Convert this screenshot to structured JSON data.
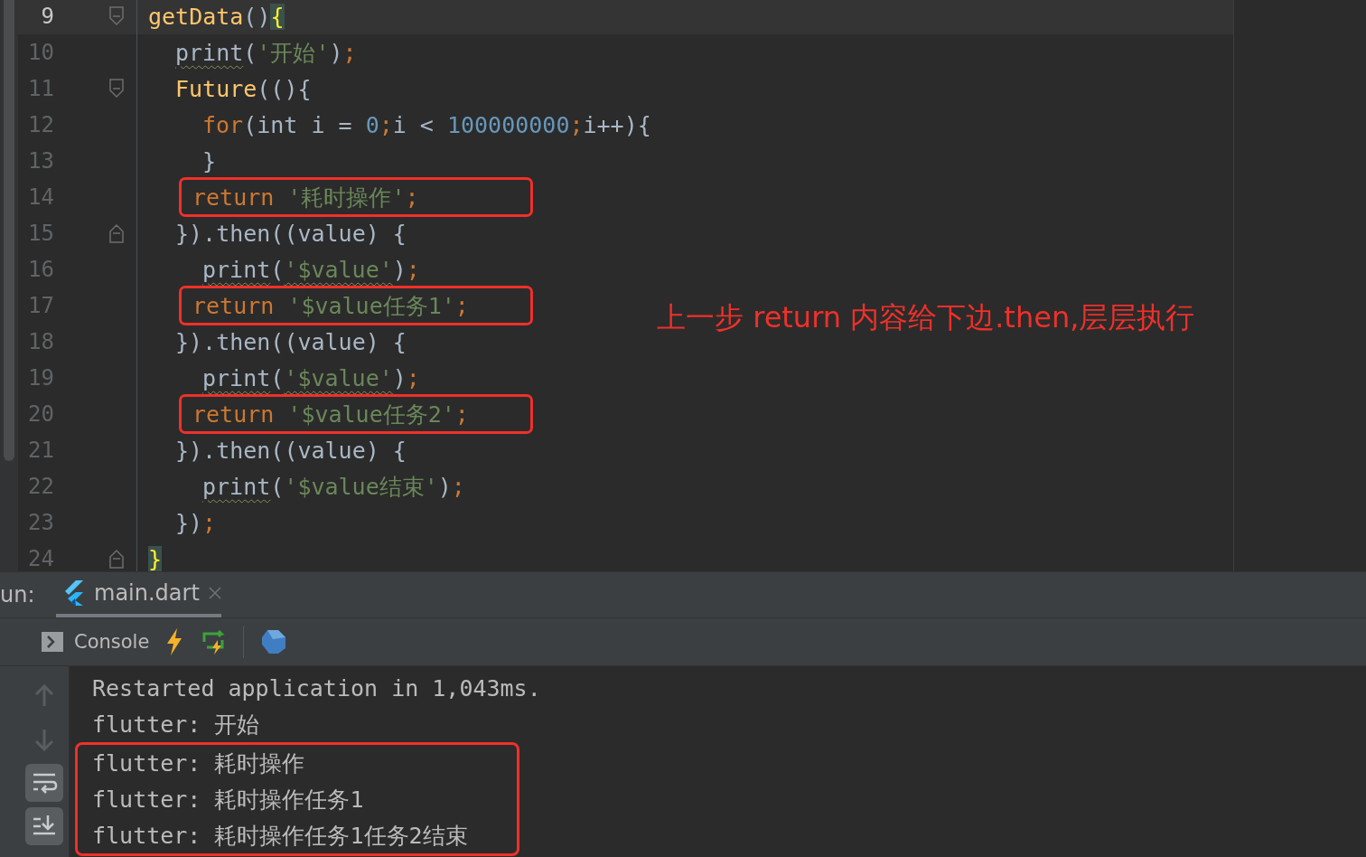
{
  "editor": {
    "lines": [
      {
        "number": "9",
        "kind": "opener",
        "current": true,
        "boxed": false,
        "tokens": [
          {
            "kind": "fn",
            "text": "getData"
          },
          {
            "kind": "plain",
            "text": "()"
          },
          {
            "kind": "brace",
            "text": "{"
          }
        ],
        "children": [
          {
            "number": "10",
            "kind": "plain",
            "current": false,
            "boxed": false,
            "tokens": [
              {
                "kind": "warn",
                "text": "print"
              },
              {
                "kind": "plain",
                "text": "("
              },
              {
                "kind": "str",
                "text": "'开始'"
              },
              {
                "kind": "plain",
                "text": ")"
              },
              {
                "kind": "kw",
                "text": ";"
              }
            ]
          },
          {
            "number": "11",
            "kind": "opener",
            "current": false,
            "boxed": false,
            "tokens": [
              {
                "kind": "fn",
                "text": "Future"
              },
              {
                "kind": "plain",
                "text": "((){"
              }
            ],
            "children": [
              {
                "number": "12",
                "kind": "plain",
                "current": false,
                "boxed": false,
                "tokens": [
                  {
                    "kind": "kw",
                    "text": "for"
                  },
                  {
                    "kind": "plain",
                    "text": "(int i = "
                  },
                  {
                    "kind": "num",
                    "text": "0"
                  },
                  {
                    "kind": "kw",
                    "text": ";"
                  },
                  {
                    "kind": "plain",
                    "text": "i < "
                  },
                  {
                    "kind": "num",
                    "text": "100000000"
                  },
                  {
                    "kind": "kw",
                    "text": ";"
                  },
                  {
                    "kind": "plain",
                    "text": "i++){"
                  }
                ]
              },
              {
                "number": "13",
                "kind": "plain",
                "current": false,
                "boxed": false,
                "tokens": [
                  {
                    "kind": "plain",
                    "text": "}"
                  }
                ]
              },
              {
                "number": "14",
                "kind": "plain",
                "current": false,
                "boxed": true,
                "tokens": [
                  {
                    "kind": "kw",
                    "text": "return "
                  },
                  {
                    "kind": "str",
                    "text": "'耗时操作'"
                  },
                  {
                    "kind": "kw",
                    "text": ";"
                  }
                ]
              }
            ]
          },
          {
            "number": "15",
            "kind": "closer",
            "current": false,
            "boxed": false,
            "tokens": [
              {
                "kind": "plain",
                "text": "}).then((value) {"
              }
            ],
            "children": [
              {
                "number": "16",
                "kind": "plain",
                "current": false,
                "boxed": false,
                "tokens": [
                  {
                    "kind": "warn",
                    "text": "print"
                  },
                  {
                    "kind": "plain",
                    "text": "("
                  },
                  {
                    "kind": "strwarn",
                    "text": "'$value'"
                  },
                  {
                    "kind": "plain",
                    "text": ")"
                  },
                  {
                    "kind": "kw",
                    "text": ";"
                  }
                ]
              },
              {
                "number": "17",
                "kind": "plain",
                "current": false,
                "boxed": true,
                "tokens": [
                  {
                    "kind": "kw",
                    "text": "return "
                  },
                  {
                    "kind": "str",
                    "text": "'$value任务1'"
                  },
                  {
                    "kind": "kw",
                    "text": ";"
                  }
                ]
              }
            ]
          },
          {
            "number": "18",
            "kind": "plain",
            "current": false,
            "boxed": false,
            "tokens": [
              {
                "kind": "plain",
                "text": "}).then((value) {"
              }
            ],
            "children": [
              {
                "number": "19",
                "kind": "plain",
                "current": false,
                "boxed": false,
                "tokens": [
                  {
                    "kind": "warn",
                    "text": "print"
                  },
                  {
                    "kind": "plain",
                    "text": "("
                  },
                  {
                    "kind": "strwarn",
                    "text": "'$value'"
                  },
                  {
                    "kind": "plain",
                    "text": ")"
                  },
                  {
                    "kind": "kw",
                    "text": ";"
                  }
                ]
              },
              {
                "number": "20",
                "kind": "plain",
                "current": false,
                "boxed": true,
                "tokens": [
                  {
                    "kind": "kw",
                    "text": "return "
                  },
                  {
                    "kind": "str",
                    "text": "'$value任务2'"
                  },
                  {
                    "kind": "kw",
                    "text": ";"
                  }
                ]
              }
            ]
          },
          {
            "number": "21",
            "kind": "plain",
            "current": false,
            "boxed": false,
            "tokens": [
              {
                "kind": "plain",
                "text": "}).then((value) {"
              }
            ],
            "children": [
              {
                "number": "22",
                "kind": "plain",
                "current": false,
                "boxed": false,
                "tokens": [
                  {
                    "kind": "warn",
                    "text": "print"
                  },
                  {
                    "kind": "plain",
                    "text": "("
                  },
                  {
                    "kind": "str",
                    "text": "'$value结束'"
                  },
                  {
                    "kind": "plain",
                    "text": ")"
                  },
                  {
                    "kind": "kw",
                    "text": ";"
                  }
                ]
              }
            ]
          },
          {
            "number": "23",
            "kind": "plain",
            "current": false,
            "boxed": false,
            "tokens": [
              {
                "kind": "plain",
                "text": "})"
              },
              {
                "kind": "kw",
                "text": ";"
              }
            ]
          }
        ]
      },
      {
        "number": "24",
        "kind": "closer",
        "current": false,
        "boxed": false,
        "tokens": [
          {
            "kind": "brace",
            "text": "}"
          }
        ]
      }
    ],
    "annotation": "上一步 return 内容给下边.then,层层执行"
  },
  "run_panel": {
    "label": "un:",
    "tabs": [
      {
        "label": "main.dart",
        "selected": true
      }
    ],
    "toolbar": {
      "console_label": "Console"
    },
    "output": [
      {
        "text": "Restarted application in 1,043ms.",
        "boxed": false
      },
      {
        "text": "flutter: 开始",
        "boxed": false
      },
      {
        "text": "flutter: 耗时操作",
        "boxed": true
      },
      {
        "text": "flutter: 耗时操作任务1",
        "boxed": true
      },
      {
        "text": "flutter: 耗时操作任务1任务2结束",
        "boxed": true
      }
    ]
  }
}
